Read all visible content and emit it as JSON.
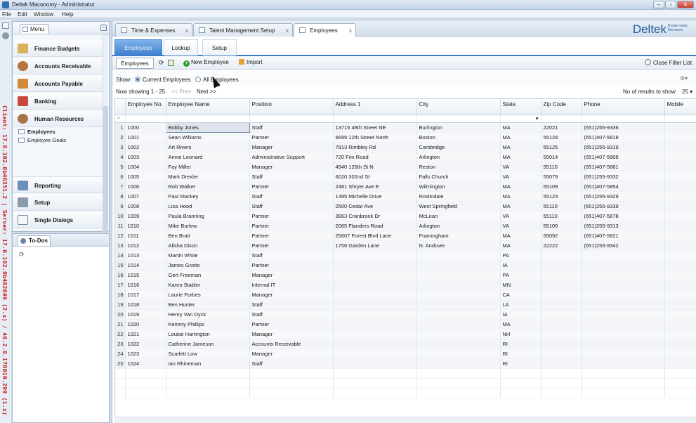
{
  "window": {
    "title": "Deltek Maconomy - Administrator"
  },
  "menubar": [
    "File",
    "Edit",
    "Window",
    "Help"
  ],
  "status_vertical": "Client: 17.0.102.0b46351.2 | Server: 17.0.102.0b462649 (2.x) / 46.2.0.170010.299 (1.x)",
  "nav": {
    "tab_label": "Menu",
    "items": [
      {
        "label": "Finance Budgets",
        "icon": "finance-icon"
      },
      {
        "label": "Accounts Receivable",
        "icon": "people-icon"
      },
      {
        "label": "Accounts Payable",
        "icon": "payable-icon"
      },
      {
        "label": "Banking",
        "icon": "bank-icon"
      },
      {
        "label": "Human Resources",
        "icon": "hr-icon"
      }
    ],
    "sub_items": [
      "Employees",
      "Employee Goals"
    ],
    "lower_items": [
      {
        "label": "Reporting",
        "icon": "report-icon"
      },
      {
        "label": "Setup",
        "icon": "tools-icon"
      },
      {
        "label": "Single Dialogs",
        "icon": "dialog-icon"
      }
    ]
  },
  "todo": {
    "tab_label": "To-Dos"
  },
  "doc_tabs": [
    {
      "label": "Time & Expenses",
      "close": "x"
    },
    {
      "label": "Talent Management Setup",
      "close": "x"
    },
    {
      "label": "Employees",
      "close": "x",
      "active": true
    }
  ],
  "brand": {
    "name": "Deltek",
    "tagline": "Know more. Do more."
  },
  "sub_tabs": [
    "Employees",
    "Lookup",
    "Setup"
  ],
  "toolbar": {
    "tab_label": "Employees",
    "new_employee": "New Employee",
    "import": "Import",
    "close_filter": "Close Filter List"
  },
  "filter": {
    "show_label": "Show:",
    "current": "Current Employees",
    "all": "All Employees"
  },
  "paging": {
    "showing": "Now showing 1 - 25",
    "prev": "<< Prev",
    "next": "Next >>",
    "results_label": "No of results to show:",
    "results_value": "25"
  },
  "grid": {
    "columns": [
      "Employee No.",
      "Employee Name",
      "Position",
      "Address 1",
      "City",
      "State",
      "Zip Code",
      "Phone",
      "Mobile"
    ],
    "rows": [
      [
        "1",
        "1000",
        "Bobby Jones",
        "Staff",
        "13715 48th Street NE",
        "Burlington",
        "MA",
        "22021",
        "(651)255-9336"
      ],
      [
        "2",
        "1001",
        "Sean Williams",
        "Partner",
        "6699 12th Street North",
        "Boston",
        "MA",
        "55128",
        "(651)407-5818"
      ],
      [
        "3",
        "1002",
        "Art Rivers",
        "Manager",
        "7813 Rimbley Rd",
        "Cambridge",
        "MA",
        "55125",
        "(651)255-9319"
      ],
      [
        "4",
        "1003",
        "Annie Leonard",
        "Administrative Support",
        "720 Fox Road",
        "Arlington",
        "MA",
        "55014",
        "(651)407-5808"
      ],
      [
        "5",
        "1004",
        "Fay Miller",
        "Manager",
        "4940 126th St N",
        "Reston",
        "VA",
        "55110",
        "(651)407-5861"
      ],
      [
        "6",
        "1005",
        "Mark Drexler",
        "Staff",
        "6020 302nd St",
        "Falls Church",
        "VA",
        "55079",
        "(651)255-9332"
      ],
      [
        "7",
        "1006",
        "Rob Walker",
        "Partner",
        "2481 Shryer Ave E",
        "Wilmington",
        "MA",
        "55109",
        "(651)407-5854"
      ],
      [
        "8",
        "1007",
        "Paul Mackey",
        "Staff",
        "1395 Michelle Drive",
        "Roslindale",
        "MA",
        "55123",
        "(651)255-9329"
      ],
      [
        "9",
        "1008",
        "Lisa Hood",
        "Staff",
        "2500 Cedar Ave",
        "West Springfield",
        "MA",
        "55110",
        "(651)255-9339"
      ],
      [
        "10",
        "1009",
        "Paula Branning",
        "Partner",
        "3963 Cranbrook Dr",
        "McLean",
        "VA",
        "55110",
        "(651)407-5878"
      ],
      [
        "11",
        "1010",
        "Mike Burlew",
        "Partner",
        "2065 Flanders Road",
        "Arlington",
        "VA",
        "55109",
        "(651)255-9313"
      ],
      [
        "12",
        "1011",
        "Ben Bratt",
        "Partner",
        "25607 Forest Blvd Lane",
        "Framingham",
        "MA",
        "55092",
        "(651)407-5821"
      ],
      [
        "13",
        "1012",
        "Alisha Dixon",
        "Partner",
        "1756 Garden Lane",
        "N. Andover",
        "MA",
        "22222",
        "(651)255-9342"
      ],
      [
        "14",
        "1013",
        "Martin White",
        "Staff",
        "",
        "",
        "PA",
        "",
        ""
      ],
      [
        "15",
        "1014",
        "James Grotto",
        "Partner",
        "",
        "",
        "IA",
        "",
        ""
      ],
      [
        "16",
        "1015",
        "Gert Freeman",
        "Manager",
        "",
        "",
        "PA",
        "",
        ""
      ],
      [
        "17",
        "1016",
        "Karen Stabler",
        "Internal IT",
        "",
        "",
        "MN",
        "",
        ""
      ],
      [
        "18",
        "1017",
        "Laurie Forbes",
        "Manager",
        "",
        "",
        "CA",
        "",
        ""
      ],
      [
        "19",
        "1018",
        "Ben Hunter",
        "Staff",
        "",
        "",
        "LA",
        "",
        ""
      ],
      [
        "20",
        "1019",
        "Henry Van Dyck",
        "Staff",
        "",
        "",
        "IA",
        "",
        ""
      ],
      [
        "21",
        "1020",
        "Kemmy Phillips",
        "Partner",
        "",
        "",
        "MA",
        "",
        ""
      ],
      [
        "22",
        "1021",
        "Louise Harrington",
        "Manager",
        "",
        "",
        "NH",
        "",
        ""
      ],
      [
        "23",
        "1022",
        "Catherine Jameson",
        "Accounts Receivable",
        "",
        "",
        "RI",
        "",
        ""
      ],
      [
        "24",
        "1023",
        "Scarlett Low",
        "Manager",
        "",
        "",
        "RI",
        "",
        ""
      ],
      [
        "25",
        "1024",
        "Ian Rhineman",
        "Staff",
        "",
        "",
        "RI",
        "",
        ""
      ]
    ]
  }
}
